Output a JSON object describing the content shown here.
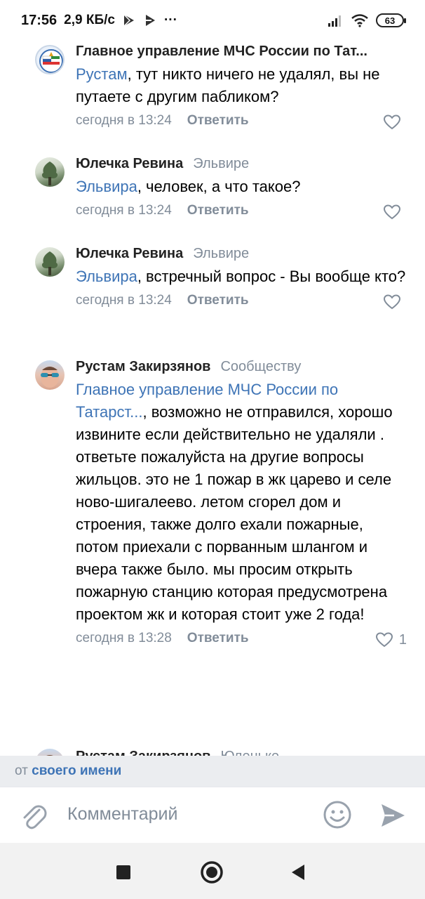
{
  "status_bar": {
    "time": "17:56",
    "network_speed": "2,9 КБ/с",
    "more_indicator": "···",
    "battery": "63"
  },
  "comments": [
    {
      "author": "Главное управление МЧС России по Тат...",
      "reply_to": "",
      "mention": "Рустам",
      "text": ", тут никто ничего не удалял, вы не путаете с другим пабликом?",
      "time": "сегодня в 13:24",
      "reply_label": "Ответить",
      "likes": ""
    },
    {
      "author": "Юлечка Ревина",
      "reply_to": "Эльвире",
      "mention": "Эльвира",
      "text": ", человек, а что такое?",
      "time": "сегодня в 13:24",
      "reply_label": "Ответить",
      "likes": ""
    },
    {
      "author": "Юлечка Ревина",
      "reply_to": "Эльвире",
      "mention": "Эльвира",
      "text": ", встречный вопрос - Вы вообще кто?",
      "time": "сегодня в 13:24",
      "reply_label": "Ответить",
      "likes": ""
    },
    {
      "author": "Рустам Закирзянов",
      "reply_to": "Сообществу",
      "mention": "Главное управление МЧС России по Татарст...",
      "text": ", возможно не отправился, хорошо извините если действительно не удаляли . ответьте пожалуйста на другие вопросы жильцов. это не 1 пожар в жк царево и селе ново-шигалеево. летом сгорел дом и строения, также долго ехали пожарные, потом приехали с порванным шлангом и вчера также было. мы просим открыть пожарную станцию которая предусмотрена проектом жк и которая стоит уже 2 года!",
      "time": "сегодня в 13:28",
      "reply_label": "Ответить",
      "likes": "1"
    },
    {
      "author": "Рустам Закирзянов",
      "reply_to": "Юленьке",
      "mention": "",
      "text": "",
      "time": "",
      "reply_label": "",
      "likes": ""
    }
  ],
  "composer": {
    "post_as_prefix": "от",
    "post_as_link": "своего имени",
    "placeholder": "Комментарий"
  },
  "icons": {
    "attach": "paperclip-icon",
    "emoji": "smile-icon",
    "send": "send-icon",
    "like": "heart-icon",
    "nav_recents": "square-icon",
    "nav_home": "circle-icon",
    "nav_back": "triangle-back-icon"
  },
  "colors": {
    "link": "#3e74b6",
    "muted": "#818c99",
    "post_as_bg": "#ebedf0",
    "navbar_bg": "#f2f2f2"
  }
}
